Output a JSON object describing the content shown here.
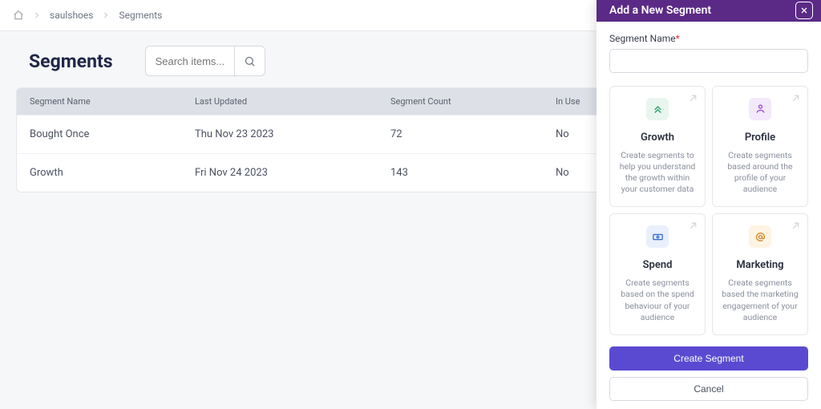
{
  "breadcrumb": {
    "org": "saulshoes",
    "page": "Segments"
  },
  "header": {
    "title": "Segments"
  },
  "search": {
    "placeholder": "Search items..."
  },
  "table": {
    "columns": {
      "name": "Segment Name",
      "updated": "Last Updated",
      "count": "Segment Count",
      "inuse": "In Use"
    },
    "rows": [
      {
        "name": "Bought Once",
        "updated": "Thu Nov 23 2023",
        "count": "72",
        "inuse": "No"
      },
      {
        "name": "Growth",
        "updated": "Fri Nov 24 2023",
        "count": "143",
        "inuse": "No"
      }
    ]
  },
  "drawer": {
    "title": "Add a New Segment",
    "field_label": "Segment Name",
    "value": "",
    "cards": [
      {
        "title": "Growth",
        "desc": "Create segments to help you understand the growth within your customer data",
        "icon": "chevrons-up",
        "pill": "green"
      },
      {
        "title": "Profile",
        "desc": "Create segments based around the profile of your audience",
        "icon": "user",
        "pill": "purple"
      },
      {
        "title": "Spend",
        "desc": "Create segments based on the spend behaviour of your audience",
        "icon": "cash",
        "pill": "blue"
      },
      {
        "title": "Marketing",
        "desc": "Create segments based the marketing engagement of your audience",
        "icon": "at",
        "pill": "orange"
      }
    ],
    "primary": "Create Segment",
    "secondary": "Cancel"
  }
}
